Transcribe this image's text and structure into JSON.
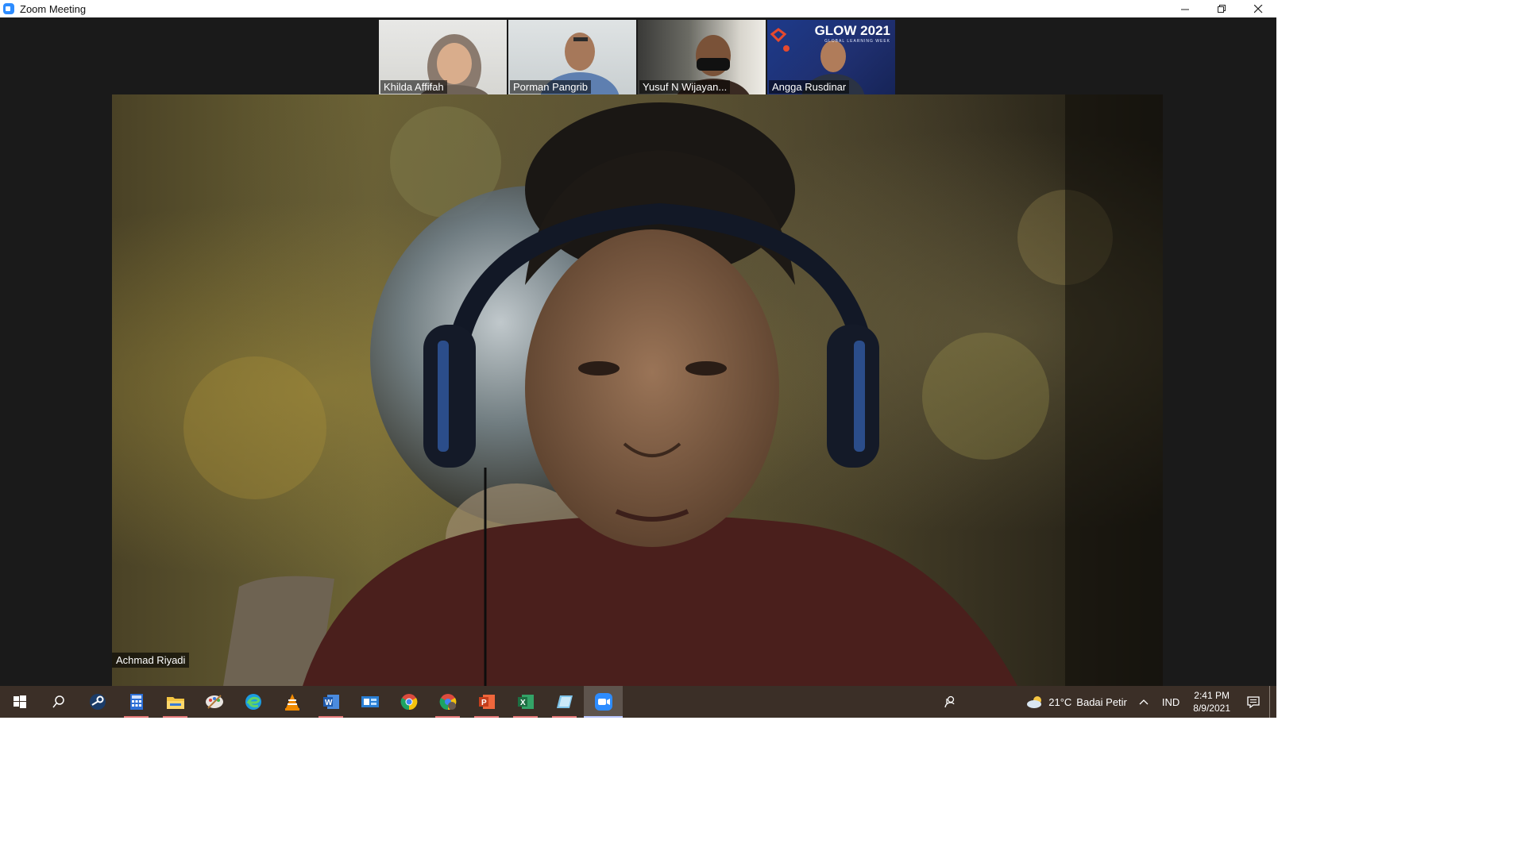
{
  "window": {
    "title": "Zoom Meeting",
    "minimize_icon": "minimize-icon",
    "restore_icon": "restore-icon",
    "close_icon": "close-icon"
  },
  "participants": [
    {
      "name": "Khilda Affifah"
    },
    {
      "name": "Porman Pangrib"
    },
    {
      "name": "Yusuf N Wijayan..."
    },
    {
      "name": "Angga Rusdinar"
    }
  ],
  "thumb_banner": {
    "title": "GLOW 2021",
    "subtitle": "GLOBAL LEARNING WEEK"
  },
  "active_speaker": {
    "name": "Achmad Riyadi"
  },
  "taskbar": {
    "icons": [
      "windows-start-icon",
      "search-icon",
      "steam-icon",
      "calculator-icon",
      "file-explorer-icon",
      "paint-icon",
      "edge-icon",
      "vlc-icon",
      "word-icon",
      "outlook-icon",
      "chrome-icon",
      "chrome-profile-icon",
      "powerpoint-icon",
      "excel-icon",
      "notes-icon",
      "zoom-icon"
    ],
    "weather_temp": "21°C",
    "weather_text": "Badai Petir",
    "language": "IND",
    "time": "2:41 PM",
    "date": "8/9/2021"
  },
  "colors": {
    "meeting_bg": "#1a1a1a",
    "taskbar_bg": "#3b2f27",
    "zoom_blue": "#2d8cff"
  }
}
